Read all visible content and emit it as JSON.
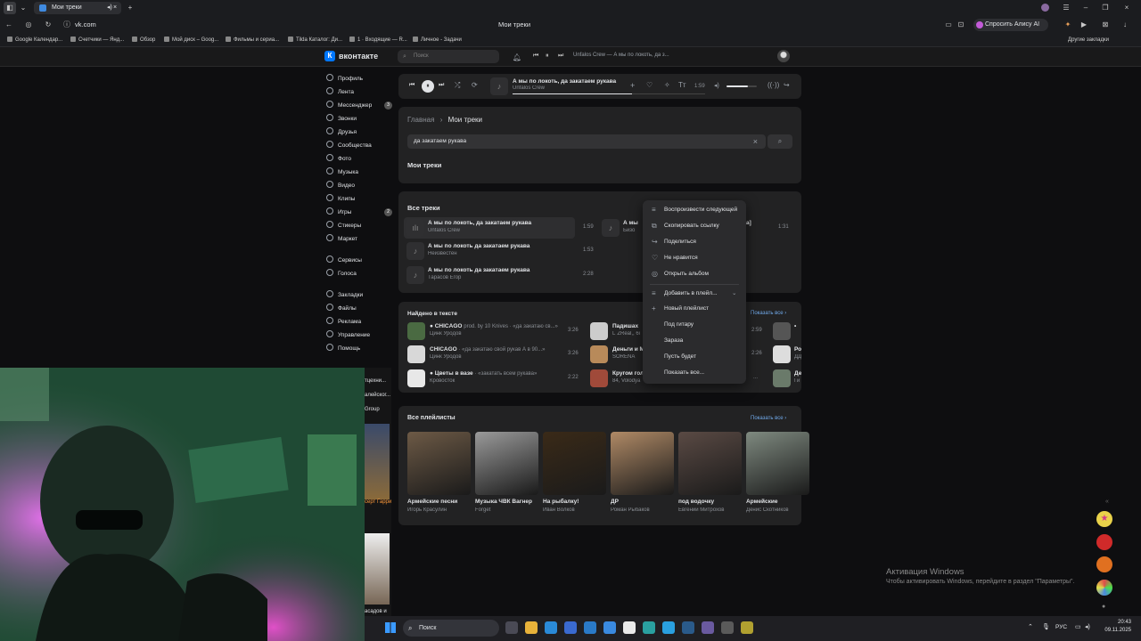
{
  "browser": {
    "tab_title": "Мои треки",
    "url": "vk.com",
    "page_title": "Мои треки",
    "alice_button": "Спросить Алису AI",
    "bookmarks": [
      "Google Календар...",
      "Счетчики — Янд...",
      "Обзор",
      "Мой диск – Goog...",
      "Фильмы и сериа...",
      "Tilda Каталог: Ди...",
      "1 · Входящие — R...",
      "Личное - Задачи"
    ],
    "other_bookmarks": "Другие закладки"
  },
  "vk": {
    "logo_text": "вконтакте",
    "search_placeholder": "Поиск",
    "header_player_text": "Unfalos Crew — А мы по локоть, да з...",
    "nav": [
      {
        "label": "Профиль"
      },
      {
        "label": "Лента"
      },
      {
        "label": "Мессенджер",
        "badge": "3"
      },
      {
        "label": "Звонки"
      },
      {
        "label": "Друзья"
      },
      {
        "label": "Сообщества"
      },
      {
        "label": "Фото"
      },
      {
        "label": "Музыка"
      },
      {
        "label": "Видео"
      },
      {
        "label": "Клипы"
      },
      {
        "label": "Игры",
        "badge": "2"
      },
      {
        "label": "Стикеры"
      },
      {
        "label": "Маркет"
      },
      {
        "label": "Сервисы"
      },
      {
        "label": "Голоса"
      },
      {
        "label": "Закладки"
      },
      {
        "label": "Файлы"
      },
      {
        "label": "Реклама"
      },
      {
        "label": "Управление"
      },
      {
        "label": "Помощь"
      }
    ]
  },
  "player": {
    "title": "А мы по локоть, да закатаем рукава",
    "artist": "Unfalos Crew",
    "time": "1:59",
    "progress": 0.62,
    "volume": 0.7
  },
  "breadcrumb": {
    "home": "Главная",
    "current": "Мои треки"
  },
  "search_query": "да закатаем рукава",
  "section_my_tracks": "Мои треки",
  "all_tracks": {
    "heading": "Все треки",
    "left": [
      {
        "title": "А мы по локоть, да закатаем рукава",
        "artist": "Unfalos Crew",
        "duration": "1:59"
      },
      {
        "title": "А мы по локоть да закатаем рукава",
        "artist": "Неизвестен",
        "duration": "1:53"
      },
      {
        "title": "А мы по локоть да закатаем рукава",
        "artist": "Тарасов Егор",
        "duration": "2:28"
      }
    ],
    "right": [
      {
        "title": "А мы",
        "artist": "Бизо",
        "duration": "1:31",
        "tail": "а]"
      }
    ]
  },
  "found_in_text": {
    "heading": "Найдено в тексте",
    "show_all": "Показать все",
    "col1": [
      {
        "title": "CHICAGO",
        "extra": "prod. by 10 Knives · «да закатаю св...»",
        "artist": "Цинк Уродов",
        "duration": "3:26"
      },
      {
        "title": "CHICAGO",
        "extra": "· «да закатаю свой рукав А в 90...»",
        "artist": "Цинк Уродов",
        "duration": "3:26"
      },
      {
        "title": "Цветы в вазе",
        "extra": "· «закатать всем рукава»",
        "artist": "Кровосток",
        "duration": "2:22"
      }
    ],
    "col2": [
      {
        "title": "Падишах",
        "artist": "L`ZReal,, 6i",
        "duration": "2:59"
      },
      {
        "title": "Деньги и М",
        "artist": "SORENA",
        "duration": "2:26"
      },
      {
        "title": "Кругом гол",
        "artist": "84, Volodya",
        "duration": "..."
      }
    ],
    "col3": [
      {
        "title": "•",
        "artist": ""
      },
      {
        "title": "Ро",
        "artist": "ДД"
      },
      {
        "title": "Де",
        "artist": "Ги"
      }
    ]
  },
  "playlists": {
    "heading": "Все плейлисты",
    "show_all": "Показать все",
    "items": [
      {
        "title": "Армейские песни",
        "author": "Игорь Красулин",
        "color": "#6d5a46"
      },
      {
        "title": "Музыка ЧВК Вагнер",
        "author": "Forget",
        "color": "#9a9a9a"
      },
      {
        "title": "На рыбалку!",
        "author": "Иван Волков",
        "color": "#3a2a18"
      },
      {
        "title": "ДР",
        "author": "Роман Рыбаков",
        "color": "#b08a66"
      },
      {
        "title": "под водочку",
        "author": "Евгений Митрохов",
        "color": "#5a4a44"
      },
      {
        "title": "Армейские",
        "author": "Денис Скотников",
        "color": "#7f8a80"
      }
    ]
  },
  "context_menu": {
    "items": [
      {
        "label": "Воспроизвести следующей",
        "icon": "play-next-icon"
      },
      {
        "label": "Скопировать ссылку",
        "icon": "copy-icon"
      },
      {
        "label": "Поделиться",
        "icon": "share-icon"
      },
      {
        "label": "Не нравится",
        "icon": "dislike-icon"
      },
      {
        "label": "Открыть альбом",
        "icon": "album-icon"
      },
      {
        "label": "Добавить в плейл...",
        "icon": "add-to-playlist-icon"
      },
      {
        "label": "Новый плейлист",
        "icon": "plus-icon"
      },
      {
        "label": "Под гитару",
        "icon": ""
      },
      {
        "label": "Зараза",
        "icon": ""
      },
      {
        "label": "Пусть будет",
        "icon": ""
      },
      {
        "label": "Показать все...",
        "icon": ""
      }
    ]
  },
  "side_partial": {
    "labels": [
      "тцехни...",
      "алейског...",
      "Group",
      "серт Гарри",
      "асадов и"
    ]
  },
  "windows": {
    "activation_title": "Активация Windows",
    "activation_text": "Чтобы активировать Windows, перейдите в раздел \"Параметры\".",
    "search": "Поиск",
    "lang": "РУС",
    "time": "20:43",
    "date": "09.11.2025"
  },
  "colors": {
    "accent": "#71aaeb",
    "vk_blue": "#0077ff",
    "background": "#0e0e10",
    "card": "#222223"
  }
}
